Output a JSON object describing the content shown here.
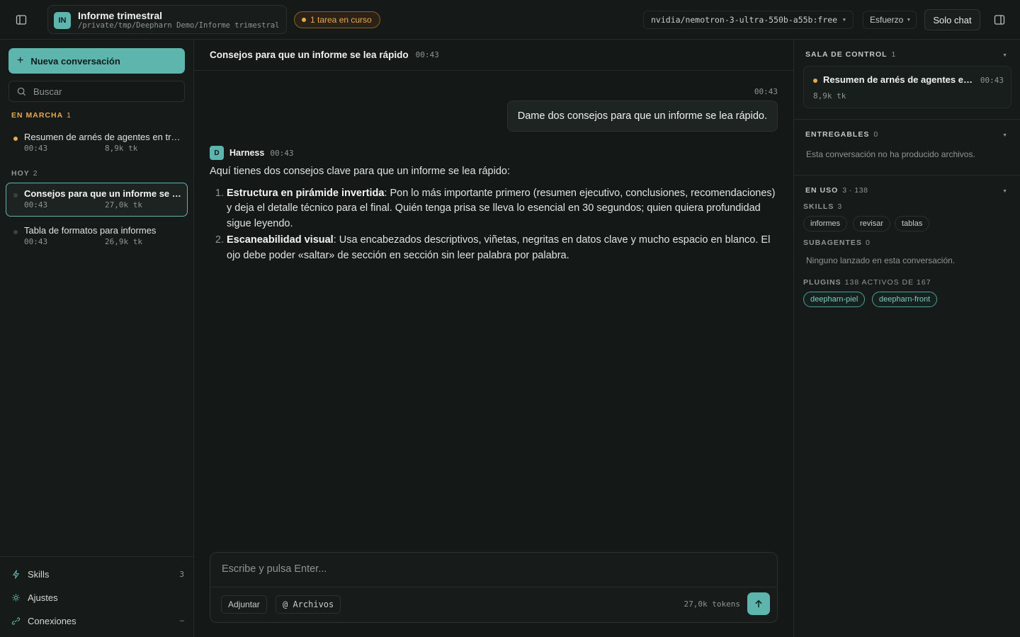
{
  "topbar": {
    "project_initials": "IN",
    "project_name": "Informe trimestral",
    "project_path": "/private/tmp/Deepharn Demo/Informe trimestral",
    "task_pill": "1 tarea en curso",
    "model": "nvidia/nemotron-3-ultra-550b-a55b:free",
    "effort": "Esfuerzo",
    "solo_chat": "Solo chat",
    "icons": {
      "left_toggle": "sidebar-left-icon",
      "right_toggle": "sidebar-right-icon"
    }
  },
  "sidebar": {
    "new_conversation": "Nueva conversación",
    "search_placeholder": "Buscar",
    "sections": [
      {
        "label": "EN MARCHA",
        "count": "1",
        "items": [
          {
            "title": "Resumen de arnés de agentes en tre...",
            "time": "00:43",
            "tokens": "8,9k tk"
          }
        ]
      },
      {
        "label": "HOY",
        "count": "2",
        "items": [
          {
            "title": "Consejos para que un informe se le...",
            "time": "00:43",
            "tokens": "27,0k tk"
          },
          {
            "title": "Tabla de formatos para informes",
            "time": "00:43",
            "tokens": "26,9k tk"
          }
        ]
      }
    ],
    "bottom": [
      {
        "label": "Skills",
        "right": "3",
        "icon": "bolt-icon"
      },
      {
        "label": "Ajustes",
        "right": "",
        "icon": "settings-icon"
      },
      {
        "label": "Conexiones",
        "right": "–",
        "icon": "link-icon"
      }
    ]
  },
  "conversation": {
    "title": "Consejos para que un informe se lea rápido",
    "time": "00:43",
    "user_message": {
      "time": "00:43",
      "text": "Dame dos consejos para que un informe se lea rápido."
    },
    "assistant": {
      "avatar": "D",
      "name": "Harness",
      "time": "00:43",
      "intro": "Aquí tienes dos consejos clave para que un informe se lea rápido:",
      "items": [
        {
          "bold": "Estructura en pirámide invertida",
          "text": ": Pon lo más importante primero (resumen ejecutivo, conclusiones, recomendaciones) y deja el detalle técnico para el final. Quién tenga prisa se lleva lo esencial en 30 segundos; quien quiera profundidad sigue leyendo."
        },
        {
          "bold": "Escaneabilidad visual",
          "text": ": Usa encabezados descriptivos, viñetas, negritas en datos clave y mucho espacio en blanco. El ojo debe poder «saltar» de sección en sección sin leer palabra por palabra."
        }
      ]
    }
  },
  "composer": {
    "placeholder": "Escribe y pulsa Enter...",
    "attach": "Adjuntar",
    "files": "@ Archivos",
    "tokens": "27,0k tokens"
  },
  "rightpanel": {
    "control": {
      "title": "SALA DE CONTROL",
      "count": "1",
      "task": {
        "title": "Resumen de arnés de agentes en t...",
        "time": "00:43",
        "tokens": "8,9k tk"
      }
    },
    "deliverables": {
      "title": "ENTREGABLES",
      "count": "0",
      "empty": "Esta conversación no ha producido archivos."
    },
    "in_use": {
      "title": "EN USO",
      "count": "3 · 138",
      "skills_label": "SKILLS",
      "skills_count": "3",
      "skills": [
        "informes",
        "revisar",
        "tablas"
      ],
      "subagents_label": "SUBAGENTES",
      "subagents_count": "0",
      "subagents_empty": "Ninguno lanzado en esta conversación.",
      "plugins_label": "PLUGINS",
      "plugins_count": "138 ACTIVOS DE 167",
      "plugins": [
        "deepharn-piel",
        "deepharn-front"
      ]
    }
  },
  "colors": {
    "accent": "#5db5ad",
    "amber": "#e9a94d",
    "bg": "#141917"
  }
}
